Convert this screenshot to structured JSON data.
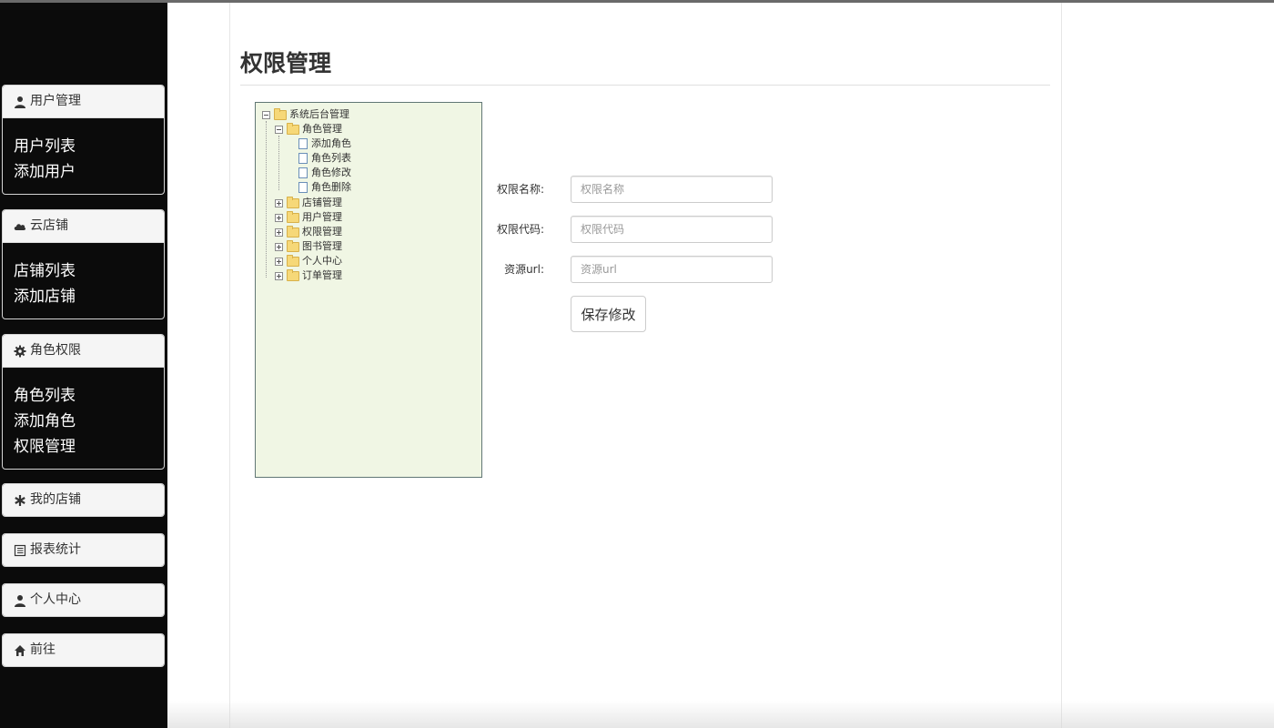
{
  "sidebar": {
    "panels": [
      {
        "title": "用户管理",
        "icon": "user-icon",
        "items": [
          "用户列表",
          "添加用户"
        ]
      },
      {
        "title": "云店铺",
        "icon": "cloud-icon",
        "items": [
          "店铺列表",
          "添加店铺"
        ]
      },
      {
        "title": "角色权限",
        "icon": "gear-icon",
        "items": [
          "角色列表",
          "添加角色",
          "权限管理"
        ]
      },
      {
        "title": "我的店铺",
        "icon": "asterisk-icon",
        "items": []
      },
      {
        "title": "报表统计",
        "icon": "list-alt-icon",
        "items": []
      },
      {
        "title": "个人中心",
        "icon": "user-icon",
        "items": []
      },
      {
        "title": "前往",
        "icon": "home-icon",
        "items": []
      }
    ]
  },
  "main": {
    "title": "权限管理"
  },
  "tree": {
    "root": "系统后台管理",
    "role_group": "角色管理",
    "role_children": [
      "添加角色",
      "角色列表",
      "角色修改",
      "角色删除"
    ],
    "collapsed_groups": [
      "店铺管理",
      "用户管理",
      "权限管理",
      "图书管理",
      "个人中心",
      "订单管理"
    ]
  },
  "form": {
    "name_label": "权限名称:",
    "name_placeholder": "权限名称",
    "code_label": "权限代码:",
    "code_placeholder": "权限代码",
    "url_label": "资源url:",
    "url_placeholder": "资源url",
    "save_label": "保存修改"
  }
}
